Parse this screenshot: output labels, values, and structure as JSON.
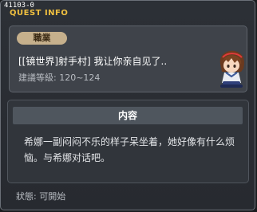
{
  "window": {
    "quest_id": "41103-0",
    "title": "QUEST INFO"
  },
  "quest": {
    "job_label": "職業",
    "name": "[[镜世界]射手村] 我让你亲自见了..",
    "level_label": "建議等級: 120~124",
    "npc_icon": "npc-girl-sitting-portrait"
  },
  "content": {
    "header": "内容",
    "body": "希娜一副闷闷不乐的样子呆坐着，她好像有什么烦恼。与希娜对话吧。"
  },
  "status": {
    "text": "狀態: 可開始"
  },
  "colors": {
    "title": "#f0c040",
    "badge": "#c6b08c",
    "panel": "#3f434a",
    "content_header": "#4f565e"
  }
}
